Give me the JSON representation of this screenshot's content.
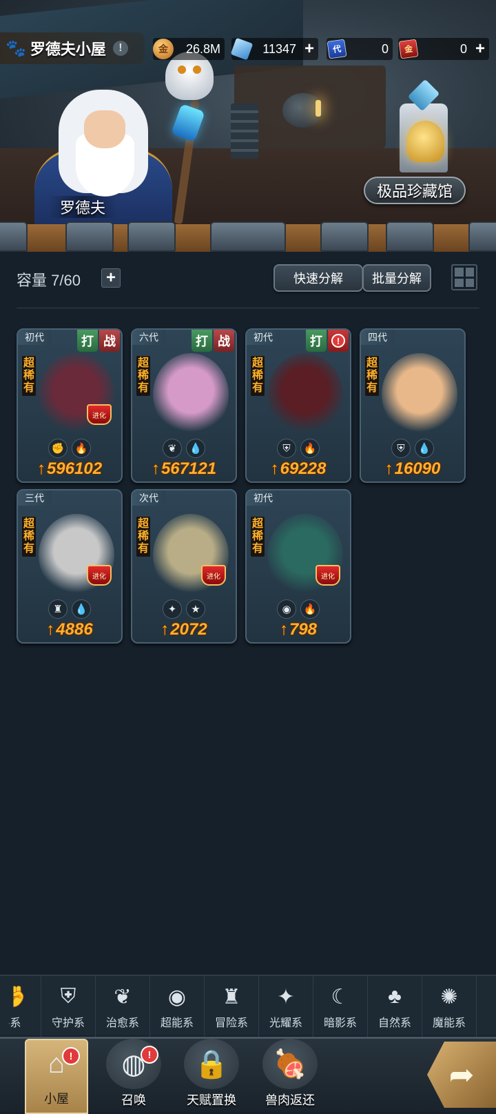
{
  "header": {
    "home_name": "罗德夫小屋",
    "info_icon": "!",
    "resources": [
      {
        "icon": "coin-icon",
        "symbol": "金",
        "value": "26.8M",
        "has_plus": false
      },
      {
        "icon": "crystal-icon",
        "symbol": "◆",
        "value": "11347",
        "has_plus": true
      },
      {
        "icon": "blue-ticket-icon",
        "symbol": "代",
        "value": "0",
        "has_plus": false
      },
      {
        "icon": "red-ticket-icon",
        "symbol": "金",
        "value": "0",
        "has_plus": true
      }
    ]
  },
  "scene": {
    "npc_name": "罗德夫",
    "museum_button": "极品珍藏馆"
  },
  "toolbar": {
    "capacity_label": "容量 7/60",
    "quick_decompose": "快速分解",
    "batch_decompose": "批量分解"
  },
  "cards": [
    {
      "generation": "初代",
      "rarity": "超稀有",
      "tags": [
        "打",
        "战"
      ],
      "alert": false,
      "types": [
        "fist-type-icon",
        "fire-type-icon"
      ],
      "type_glyphs": [
        "✊",
        "🔥"
      ],
      "power": "596102",
      "evolve_badge": true,
      "art_color": "#6b2a3a"
    },
    {
      "generation": "六代",
      "rarity": "超稀有",
      "tags": [
        "打",
        "战"
      ],
      "alert": false,
      "types": [
        "sprout-type-icon",
        "water-type-icon"
      ],
      "type_glyphs": [
        "❦",
        "💧"
      ],
      "power": "567121",
      "evolve_badge": false,
      "art_color": "#d69ac8"
    },
    {
      "generation": "初代",
      "rarity": "超稀有",
      "tags": [
        "打"
      ],
      "alert": true,
      "types": [
        "shield-type-icon",
        "fire-type-icon"
      ],
      "type_glyphs": [
        "⛨",
        "🔥"
      ],
      "power": "69228",
      "evolve_badge": false,
      "art_color": "#5a1e24"
    },
    {
      "generation": "四代",
      "rarity": "超稀有",
      "tags": [],
      "alert": false,
      "types": [
        "shield-type-icon",
        "water-type-icon"
      ],
      "type_glyphs": [
        "⛨",
        "💧"
      ],
      "power": "16090",
      "evolve_badge": false,
      "art_color": "#e8b88a"
    },
    {
      "generation": "三代",
      "rarity": "超稀有",
      "tags": [],
      "alert": false,
      "types": [
        "adventure-type-icon",
        "water-type-icon"
      ],
      "type_glyphs": [
        "♜",
        "💧"
      ],
      "power": "4886",
      "evolve_badge": true,
      "art_color": "#c8c8c8"
    },
    {
      "generation": "次代",
      "rarity": "超稀有",
      "tags": [],
      "alert": false,
      "types": [
        "light-type-icon",
        "star-type-icon"
      ],
      "type_glyphs": [
        "✦",
        "★"
      ],
      "power": "2072",
      "evolve_badge": true,
      "art_color": "#b8ad86"
    },
    {
      "generation": "初代",
      "rarity": "超稀有",
      "tags": [],
      "alert": false,
      "types": [
        "psychic-type-icon",
        "fire-type-icon"
      ],
      "type_glyphs": [
        "◉",
        "🔥"
      ],
      "power": "798",
      "evolve_badge": true,
      "art_color": "#2a6a60"
    }
  ],
  "evolve_label": "进化",
  "filters": [
    {
      "label": "斗系",
      "icon": "fist-type-icon",
      "glyph": "✊"
    },
    {
      "label": "守护系",
      "icon": "shield-type-icon",
      "glyph": "⛨"
    },
    {
      "label": "治愈系",
      "icon": "sprout-type-icon",
      "glyph": "❦"
    },
    {
      "label": "超能系",
      "icon": "psychic-type-icon",
      "glyph": "◉"
    },
    {
      "label": "冒险系",
      "icon": "adventure-type-icon",
      "glyph": "♜"
    },
    {
      "label": "光耀系",
      "icon": "light-type-icon",
      "glyph": "✦"
    },
    {
      "label": "暗影系",
      "icon": "shadow-type-icon",
      "glyph": "☾"
    },
    {
      "label": "自然系",
      "icon": "nature-type-icon",
      "glyph": "♣"
    },
    {
      "label": "魔能系",
      "icon": "magic-type-icon",
      "glyph": "✺"
    }
  ],
  "bottom_nav": [
    {
      "label": "小屋",
      "icon": "cabin-icon",
      "glyph": "⌂",
      "active": true,
      "notification": true
    },
    {
      "label": "召唤",
      "icon": "egg-icon",
      "glyph": "◍",
      "active": false,
      "notification": true
    },
    {
      "label": "天赋置换",
      "icon": "lock-icon",
      "glyph": "🔒",
      "active": false,
      "notification": false
    },
    {
      "label": "兽肉返还",
      "icon": "meat-icon",
      "glyph": "🍖",
      "active": false,
      "notification": false
    }
  ],
  "notification_mark": "!",
  "exit_arrow_glyph": "➦"
}
